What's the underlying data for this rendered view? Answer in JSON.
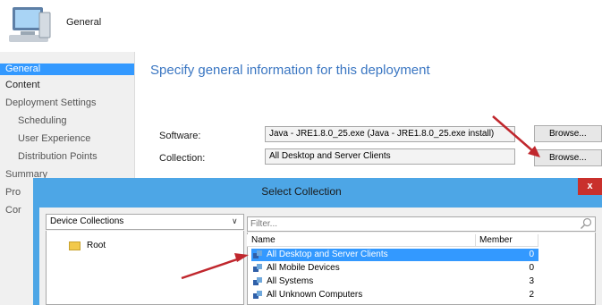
{
  "header": {
    "title": "General",
    "icon": "computer-icon"
  },
  "nav": {
    "items": [
      {
        "label": "General",
        "selected": true
      },
      {
        "label": "Content"
      },
      {
        "label": "Deployment Settings"
      },
      {
        "label": "Scheduling"
      },
      {
        "label": "User Experience"
      },
      {
        "label": "Distribution Points"
      },
      {
        "label": "Summary"
      },
      {
        "label": "Pro"
      },
      {
        "label": "Cor"
      }
    ]
  },
  "main": {
    "heading": "Specify general information for this deployment",
    "software": {
      "label": "Software:",
      "value": "Java - JRE1.8.0_25.exe (Java - JRE1.8.0_25.exe install)",
      "browse_label": "Browse..."
    },
    "collection": {
      "label": "Collection:",
      "value": "All Desktop and Server Clients",
      "browse_label": "Browse..."
    }
  },
  "dialog": {
    "title": "Select Collection",
    "close_label": "x",
    "collection_type": "Device Collections",
    "tree_root": "Root",
    "filter_placeholder": "Filter...",
    "columns": {
      "name": "Name",
      "member_count": "Member Count"
    },
    "rows": [
      {
        "name": "All Desktop and Server Clients",
        "count": "0",
        "selected": true
      },
      {
        "name": "All Mobile Devices",
        "count": "0"
      },
      {
        "name": "All Systems",
        "count": "3"
      },
      {
        "name": "All Unknown Computers",
        "count": "2"
      }
    ]
  },
  "colors": {
    "selection": "#3399ff",
    "heading": "#3a76c2",
    "dialog_frame": "#4da6e6",
    "close": "#c9302c",
    "arrow": "#c0272d"
  }
}
